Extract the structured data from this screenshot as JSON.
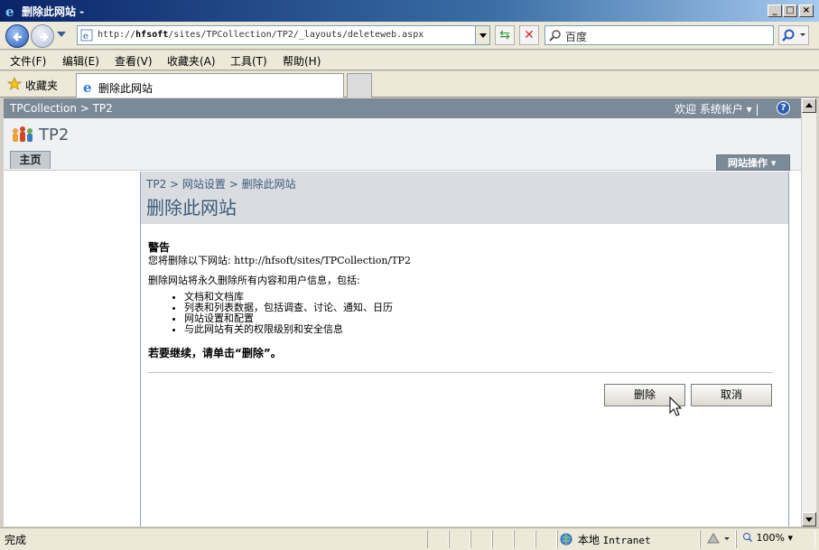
{
  "window": {
    "title": "删除此网站 -"
  },
  "addressbar": {
    "url_prefix": "http://",
    "url_host": "hfsoft",
    "url_path": "/sites/TPCollection/TP2/_layouts/deleteweb.aspx"
  },
  "search": {
    "text": "百度"
  },
  "menu": {
    "items": [
      "文件(F)",
      "编辑(E)",
      "查看(V)",
      "收藏夹(A)",
      "工具(T)",
      "帮助(H)"
    ]
  },
  "favorites": {
    "label": "收藏夹"
  },
  "tab": {
    "label": "删除此网站"
  },
  "sharepoint": {
    "top_breadcrumb": "TPCollection > TP2",
    "welcome": "欢迎  系统帐户 ▾  |",
    "site_name": "TP2",
    "home_tab": "主页",
    "site_actions": "网站操作 ▾",
    "breadcrumb": "TP2  >  网站设置  > 删除此网站",
    "page_title": "删除此网站"
  },
  "body": {
    "warning_heading": "警告",
    "delete_site_prefix": "您将删除以下网站:",
    "delete_site_url": "http://hfsoft/sites/TPCollection/TP2",
    "permanent_notice": "删除网站将永久删除所有内容和用户信息，包括:",
    "bullets": [
      "文档和文档库",
      "列表和列表数据，包括调查、讨论、通知、日历",
      "网站设置和配置",
      "与此网站有关的权限级别和安全信息"
    ],
    "confirm": "若要继续，请单击“删除”。",
    "delete_button": "删除",
    "cancel_button": "取消"
  },
  "statusbar": {
    "status": "完成",
    "zone_label": "本地",
    "zone_name": "Intranet",
    "zoom": "100%"
  },
  "colors": {
    "accent": "#3d5a78",
    "title_gray": "#7b8a97"
  }
}
